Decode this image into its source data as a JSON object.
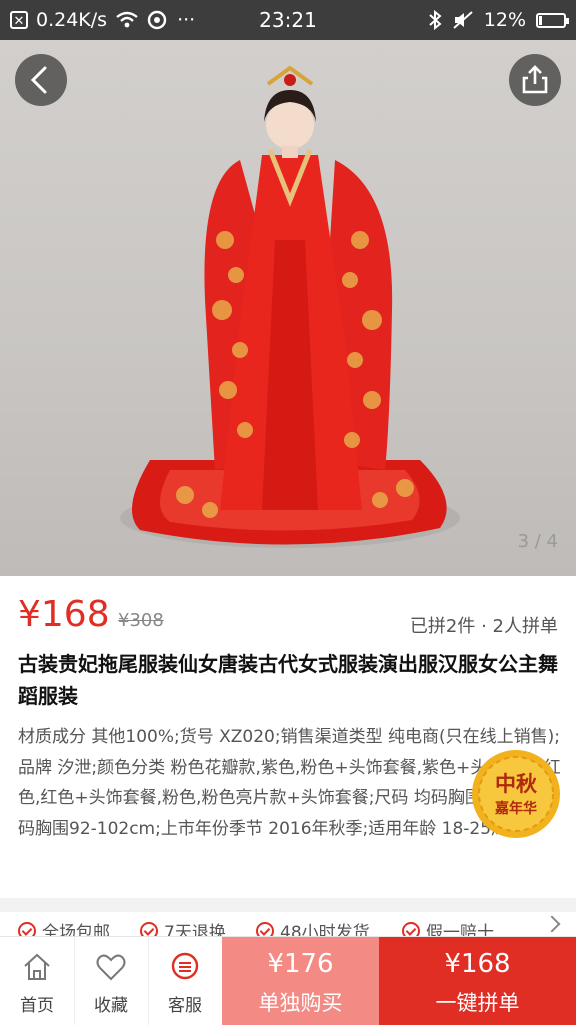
{
  "status_bar": {
    "notification_icon": "close-box-icon",
    "net_speed": "0.24K/s",
    "time": "23:21",
    "battery": "12%",
    "battery_level": 0.12
  },
  "hero": {
    "image_counter": "3 / 4"
  },
  "product": {
    "price": "¥168",
    "original_price": "¥308",
    "group_info": "已拼2件 · 2人拼单",
    "title": "古装贵妃拖尾服装仙女唐装古代女式服装演出服汉服女公主舞蹈服装",
    "description": "材质成分 其他100%;货号 XZ020;销售渠道类型 纯电商(只在线上销售);品牌 汐泄;颜色分类 粉色花瓣款,紫色,粉色+头饰套餐,紫色+头饰套餐,红色,红色+头饰套餐,粉色,粉色亮片款+头饰套餐;尺码 均码胸围92cm,大码胸围92-102cm;上市年份季节 2016年秋季;适用年龄 18-25周岁"
  },
  "badge": {
    "line1": "中秋",
    "line2": "嘉年华"
  },
  "services": [
    "全场包邮",
    "7天退换",
    "48小时发货",
    "假一赔十"
  ],
  "bottom_bar": {
    "tabs": [
      {
        "label": "首页",
        "icon": "home-icon"
      },
      {
        "label": "收藏",
        "icon": "heart-icon"
      },
      {
        "label": "客服",
        "icon": "chat-icon"
      }
    ],
    "single_buy": {
      "price": "¥176",
      "label": "单独购买"
    },
    "group_buy": {
      "price": "¥168",
      "label": "一键拼单"
    }
  },
  "colors": {
    "accent": "#e02e24",
    "accent_light": "#f38a84",
    "dress": "#e3231d"
  }
}
